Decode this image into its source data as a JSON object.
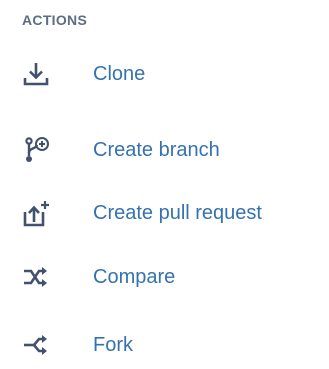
{
  "sidebar": {
    "section_title": "ACTIONS",
    "items": [
      {
        "label": "Clone",
        "icon": "download-icon"
      },
      {
        "label": "Create branch",
        "icon": "branch-add-icon"
      },
      {
        "label": "Create pull request",
        "icon": "pull-request-add-icon"
      },
      {
        "label": "Compare",
        "icon": "compare-icon"
      },
      {
        "label": "Fork",
        "icon": "fork-icon"
      }
    ]
  },
  "colors": {
    "link": "#3572b0",
    "heading": "#5e6c84",
    "icon": "#42526e"
  }
}
